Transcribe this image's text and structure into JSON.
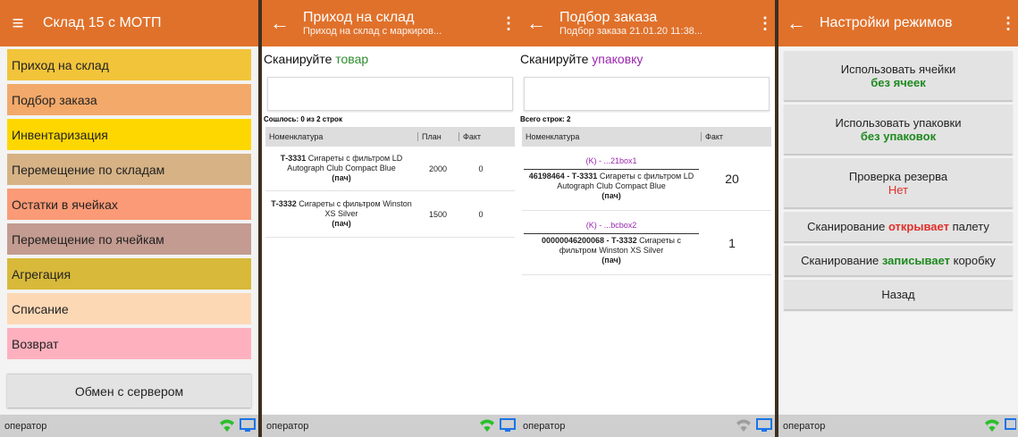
{
  "colors": {
    "accent": "#e0712b",
    "status_bar": "#cfcfcf",
    "green": "#2e8b2e",
    "purple": "#9b27b0",
    "red": "#e0312b"
  },
  "main_menu": {
    "title": "Склад 15 с МОТП",
    "items": [
      {
        "label": "Приход на склад",
        "color": "#f2c43a"
      },
      {
        "label": "Подбор заказа",
        "color": "#f2a96a"
      },
      {
        "label": "Инвентаризация",
        "color": "#ffd700"
      },
      {
        "label": "Перемещение по складам",
        "color": "#d6b285"
      },
      {
        "label": "Остатки в ячейках",
        "color": "#fb9a76"
      },
      {
        "label": "Перемещение по ячейкам",
        "color": "#c39b90"
      },
      {
        "label": "Агрегация",
        "color": "#d8b93a"
      },
      {
        "label": "Списание",
        "color": "#fdd8b5"
      },
      {
        "label": "Возврат",
        "color": "#ffb0be"
      }
    ],
    "server_button": "Обмен с сервером",
    "status": "оператор"
  },
  "receipt": {
    "title": "Приход на склад",
    "subtitle": "Приход на склад с маркиров...",
    "prompt_prefix": "Сканируйте ",
    "prompt_target": "товар",
    "info": "Сошлось: 0 из 2 строк",
    "columns": [
      "Номенклатура",
      "План",
      "Факт"
    ],
    "rows": [
      {
        "code": "Т-3331",
        "name": " Сигареты с фильтром LD Autograph Club Compact Blue",
        "unit": "(пач)",
        "plan": "2000",
        "fact": "0"
      },
      {
        "code": "Т-3332",
        "name": " Сигареты с фильтром Winston XS Silver",
        "unit": "(пач)",
        "plan": "1500",
        "fact": "0"
      }
    ],
    "status": "оператор"
  },
  "picking": {
    "title": "Подбор заказа",
    "subtitle": "Подбор заказа 21.01.20 11:38...",
    "prompt_prefix": "Сканируйте ",
    "prompt_target": "упаковку",
    "info": "Всего строк: 2",
    "columns": [
      "Номенклатура",
      "Факт"
    ],
    "rows": [
      {
        "package": "(K) - ...21box1",
        "code": "46198464 - Т-3331",
        "name": " Сигареты с фильтром LD Autograph Club Compact Blue",
        "unit": "(пач)",
        "fact": "20"
      },
      {
        "package": "(K) - ...bcbox2",
        "code": "00000046200068 - Т-3332",
        "name": " Сигареты с фильтром Winston XS Silver",
        "unit": "(пач)",
        "fact": "1"
      }
    ],
    "status": "оператор"
  },
  "settings": {
    "title": "Настройки режимов",
    "use_cells_label": "Использовать ячейки",
    "use_cells_value": "без ячеек",
    "use_packages_label": "Использовать упаковки",
    "use_packages_value": "без упаковок",
    "reserve_check_label": "Проверка резерва",
    "reserve_check_value": "Нет",
    "scan_opens_prefix": "Сканирование ",
    "scan_opens_hl": "открывает",
    "scan_opens_suffix": " палету",
    "scan_writes_prefix": "Сканирование ",
    "scan_writes_hl": "записывает",
    "scan_writes_suffix": " коробку",
    "back_label": "Назад",
    "status": "оператор"
  }
}
